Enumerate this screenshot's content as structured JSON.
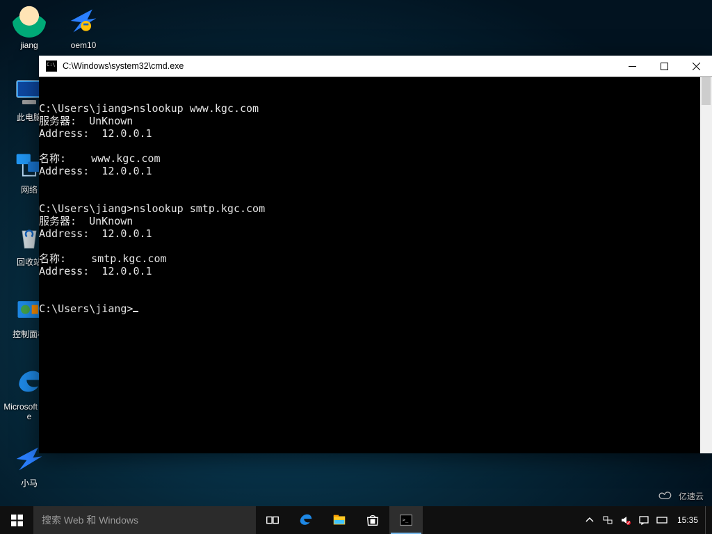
{
  "desktop_icons": {
    "jiang": "jiang",
    "oem10": "oem10",
    "this_pc": "此电脑",
    "network": "网络",
    "recycle": "回收站",
    "control": "控制面板",
    "edge": "Microsoft Edge",
    "pony": "小马"
  },
  "cmd": {
    "title": "C:\\Windows\\system32\\cmd.exe",
    "lines": {
      "l1": "C:\\Users\\jiang>nslookup www.kgc.com",
      "l2": "服务器:  UnKnown",
      "l3": "Address:  12.0.0.1",
      "l4": "",
      "l5": "名称:    www.kgc.com",
      "l6": "Address:  12.0.0.1",
      "l7": "",
      "l8": "",
      "l9": "C:\\Users\\jiang>nslookup smtp.kgc.com",
      "l10": "服务器:  UnKnown",
      "l11": "Address:  12.0.0.1",
      "l12": "",
      "l13": "名称:    smtp.kgc.com",
      "l14": "Address:  12.0.0.1",
      "l15": "",
      "l16": "",
      "l17": "C:\\Users\\jiang>"
    }
  },
  "taskbar": {
    "search_placeholder": "搜索 Web 和 Windows",
    "time": "15:35",
    "date": ""
  },
  "watermark": "亿速云"
}
